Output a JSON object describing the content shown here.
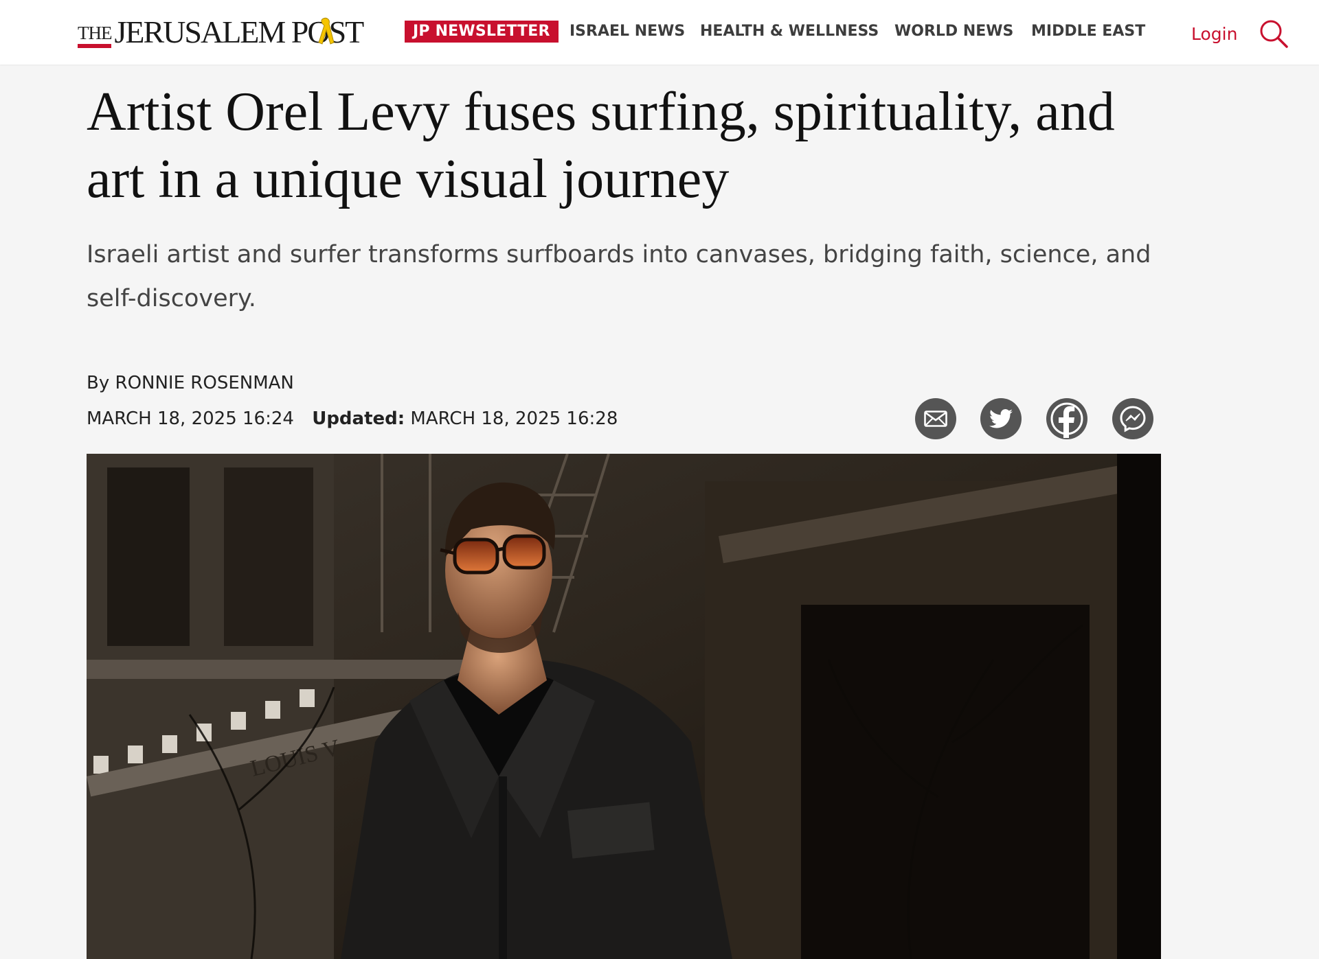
{
  "header": {
    "logo": {
      "the": "THE",
      "name": "JERUSALEM POST"
    },
    "newsletter_label": "JP NEWSLETTER",
    "nav": [
      "ISRAEL NEWS",
      "HEALTH & WELLNESS",
      "WORLD NEWS",
      "MIDDLE EAST"
    ],
    "login_label": "Login",
    "search_icon": "search-icon",
    "brand_color": "#c8102e",
    "ribbon_color": "#f5c400"
  },
  "article": {
    "headline": "Artist Orel Levy fuses surfing, spirituality, and art in a unique visual journey",
    "subheadline": "Israeli artist and surfer transforms surfboards into canvases, bridging faith, science, and self-discovery.",
    "byline_prefix": "By",
    "author": "RONNIE ROSENMAN",
    "published": "MARCH 18, 2025 16:24",
    "updated_label": "Updated:",
    "updated": "MARCH 18, 2025 16:28",
    "share": [
      "email-icon",
      "twitter-icon",
      "facebook-icon",
      "messenger-icon"
    ],
    "hero_image": {
      "sign_text": "LOUIS V"
    }
  }
}
